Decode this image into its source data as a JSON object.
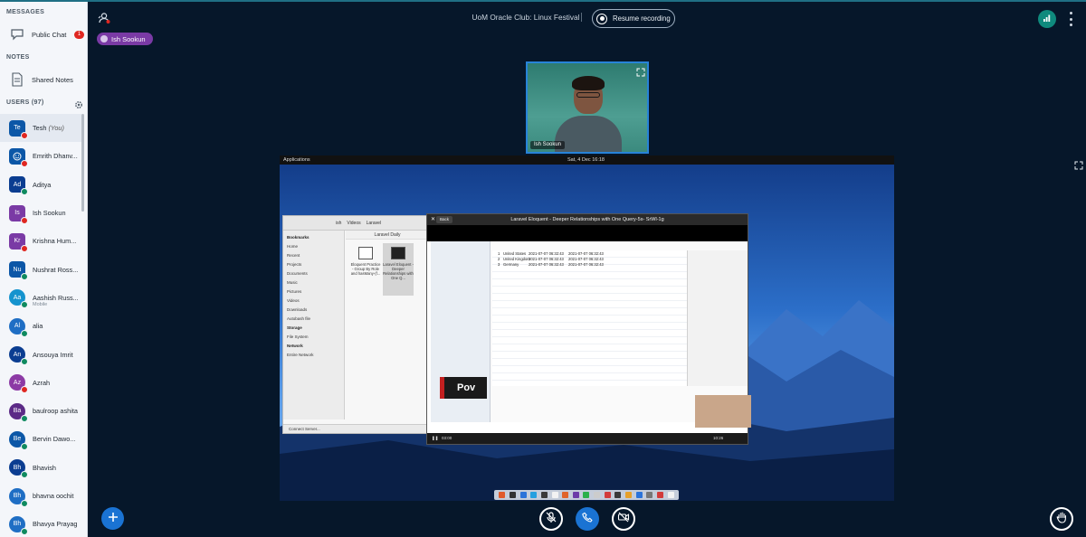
{
  "sidebar": {
    "messages_title": "MESSAGES",
    "public_chat_label": "Public Chat",
    "public_chat_unread": "1",
    "notes_title": "NOTES",
    "shared_notes_label": "Shared Notes",
    "users_title": "USERS (97)",
    "users": [
      {
        "initials": "Te",
        "name": "Tesh",
        "suffix": "(You)",
        "color": "#0c57a7",
        "shape": "square",
        "status": "muted"
      },
      {
        "initials": "",
        "name": "Emrith Dhanv...",
        "color": "#0c57a7",
        "shape": "square",
        "status": "muted",
        "icon": "smiley-icon"
      },
      {
        "initials": "Ad",
        "name": "Aditya",
        "color": "#0b3d91",
        "shape": "square",
        "status": "listen"
      },
      {
        "initials": "Is",
        "name": "Ish Sookun",
        "color": "#7a3aa5",
        "shape": "square",
        "status": "muted"
      },
      {
        "initials": "Kr",
        "name": "Krishna Hum...",
        "color": "#7a3aa5",
        "shape": "square",
        "status": "muted"
      },
      {
        "initials": "Nu",
        "name": "Nushrat Ross...",
        "color": "#0c57a7",
        "shape": "square",
        "status": "listen"
      },
      {
        "initials": "Aa",
        "name": "Aashish Russ...",
        "sub": "Mobile",
        "color": "#1593ce",
        "shape": "round",
        "status": "listen"
      },
      {
        "initials": "Al",
        "name": "alia",
        "color": "#1f6ec4",
        "shape": "round",
        "status": "listen"
      },
      {
        "initials": "An",
        "name": "Ansouya Imrit",
        "color": "#0b3d91",
        "shape": "round",
        "status": "listen"
      },
      {
        "initials": "Az",
        "name": "Azrah",
        "color": "#8c3aa5",
        "shape": "round",
        "status": "muted"
      },
      {
        "initials": "Ba",
        "name": "baulroop ashita",
        "color": "#5b2a86",
        "shape": "round",
        "status": "listen"
      },
      {
        "initials": "Be",
        "name": "Bervin Dawo...",
        "color": "#0c57a7",
        "shape": "round",
        "status": "listen"
      },
      {
        "initials": "Bh",
        "name": "Bhavish",
        "color": "#0b3d91",
        "shape": "round",
        "status": "listen"
      },
      {
        "initials": "Bh",
        "name": "bhavna oochit",
        "color": "#1f6ec4",
        "shape": "round",
        "status": "listen"
      },
      {
        "initials": "Bh",
        "name": "Bhavya Prayag",
        "color": "#1f6ec4",
        "shape": "round",
        "status": "listen"
      }
    ]
  },
  "header": {
    "presenter_name": "Ish Sookun",
    "meeting_title": "UoM Oracle Club: Linux Festival",
    "record_label": "Resume recording"
  },
  "webcam": {
    "name": "Ish Sookun"
  },
  "screenshare": {
    "topbar_apps": "Applications",
    "topbar_clock": "Sat, 4 Dec   16:18",
    "file_manager": {
      "folder": "Laravel Daily",
      "path": [
        "ish",
        "Videos",
        "Laravel"
      ],
      "bookmarks_title": "Bookmarks",
      "bookmarks": [
        "Home",
        "Recent",
        "Projects",
        "Documents",
        "Music",
        "Pictures",
        "Videos",
        "Downloads",
        "Autobash file"
      ],
      "storage_title": "Storage",
      "storage": [
        "File System"
      ],
      "network_title": "Network",
      "network": [
        "Entire Network"
      ],
      "files": [
        "Eloquent Practice - Group By Role and hasMany-(f...",
        "Laravel Eloquent - Deeper Relationships with One Q..."
      ],
      "footer": "Connect Server..."
    },
    "video_player": {
      "back_label": "Back",
      "title": "Laravel Eloquent - Deeper Relationships with One Query-5s- SrWl-1g",
      "rows": [
        {
          "n": "1",
          "country": "United States",
          "created": "2021-07-07 06:32:43",
          "updated": "2021-07-07 06:32:43"
        },
        {
          "n": "2",
          "country": "United Kingdom",
          "created": "2021-07-07 06:32:43",
          "updated": "2021-07-07 06:32:43"
        },
        {
          "n": "3",
          "country": "Germany",
          "created": "2021-07-07 06:32:43",
          "updated": "2021-07-07 06:32:43"
        }
      ],
      "overlay_text": "Pov",
      "time_elapsed": "03:00",
      "time_total": "10:26"
    }
  },
  "colors": {
    "background": "#06172a",
    "sidebar_bg": "#f4f6fa",
    "accent_blue": "#1a73d3",
    "muted_red": "#df2721",
    "listen_green": "#0f8a5f",
    "presenter_purple": "#7a3aa5",
    "connection_teal": "#0f8a7d"
  },
  "icons": {
    "public_chat": "chat-bubble-icon",
    "shared_notes": "document-icon",
    "users_settings": "gear-icon",
    "presenter_toggle": "person-presenter-icon",
    "record": "record-dot-icon",
    "connection": "signal-bars-icon",
    "options": "kebab-menu-icon",
    "actions": "plus-icon",
    "mute": "microphone-muted-icon",
    "audio": "phone-icon",
    "video": "camera-off-icon",
    "raise_hand": "hand-icon",
    "fullscreen": "expand-icon"
  }
}
